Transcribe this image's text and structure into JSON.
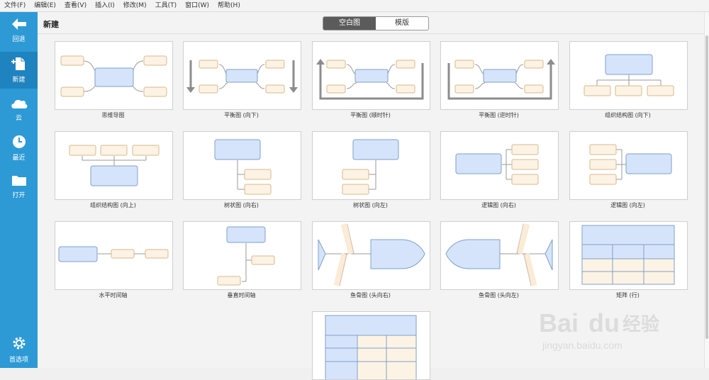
{
  "menu": [
    "文件(F)",
    "编辑(E)",
    "查看(V)",
    "插入(I)",
    "修改(M)",
    "工具(T)",
    "窗口(W)",
    "帮助(H)"
  ],
  "sidebar": {
    "back": "回退",
    "new": "新建",
    "cloud": "云",
    "recent": "最近",
    "open": "打开",
    "settings": "首选项"
  },
  "main": {
    "title": "新建",
    "tabs": [
      "空白图",
      "模版"
    ]
  },
  "templates": [
    "思维导图",
    "平衡图 (向下)",
    "平衡图 (顺时针)",
    "平衡图 (逆时针)",
    "组织结构图 (向下)",
    "组织结构图 (向上)",
    "树状图 (向右)",
    "树状图 (向左)",
    "逻辑图 (向右)",
    "逻辑图 (向左)",
    "水平时间轴",
    "垂直时间轴",
    "鱼骨图 (头向右)",
    "鱼骨图 (头向左)",
    "矩阵 (行)",
    ""
  ],
  "watermark": {
    "brand": "Baidu经验",
    "url": "jingyan.baidu.com"
  },
  "colors": {
    "sidebar": "#2d9ad6",
    "topic_fill": "#d6e4fb",
    "topic_stroke": "#7f9fcb",
    "sub_fill": "#fdf3e4",
    "sub_stroke": "#d8b98d"
  }
}
